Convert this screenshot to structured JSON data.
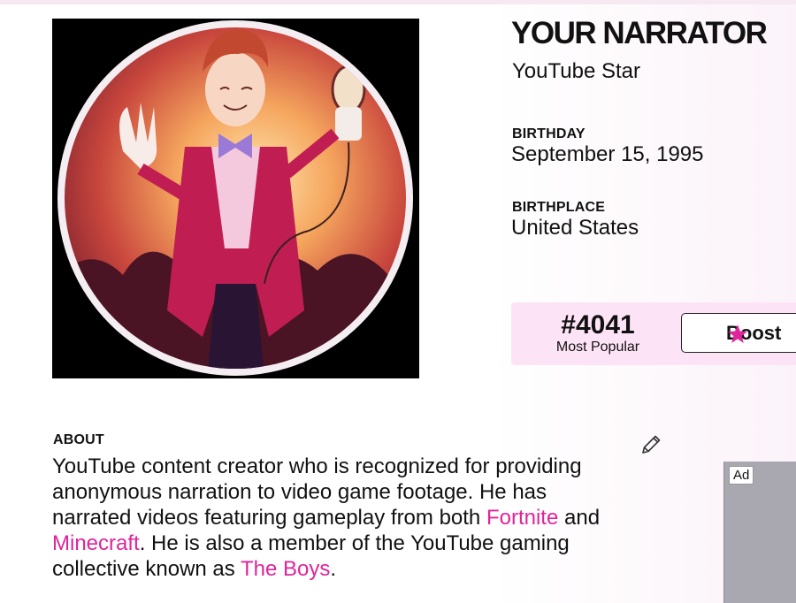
{
  "profile": {
    "name": "YOUR NARRATOR",
    "profession": "YouTube Star",
    "birthday_label": "BIRTHDAY",
    "birthday": "September 15, 1995",
    "birthplace_label": "BIRTHPLACE",
    "birthplace": "United States"
  },
  "popularity": {
    "rank": "#4041",
    "caption": "Most Popular",
    "boost_label": "Boost",
    "boost_icon": "star-icon",
    "accent_color": "#e0249a"
  },
  "about": {
    "label": "ABOUT",
    "text_1": "YouTube content creator who is recognized for providing anonymous narration to video game footage. He has narrated videos featuring gameplay from both ",
    "link_fortnite": "Fortnite",
    "text_2": " and ",
    "link_minecraft": "Minecraft",
    "text_3": ". He is also a member of the YouTube gaming collective known as ",
    "link_the_boys": "The Boys",
    "text_4": ".",
    "edit_icon": "pencil-icon"
  },
  "ad": {
    "badge": "Ad"
  }
}
